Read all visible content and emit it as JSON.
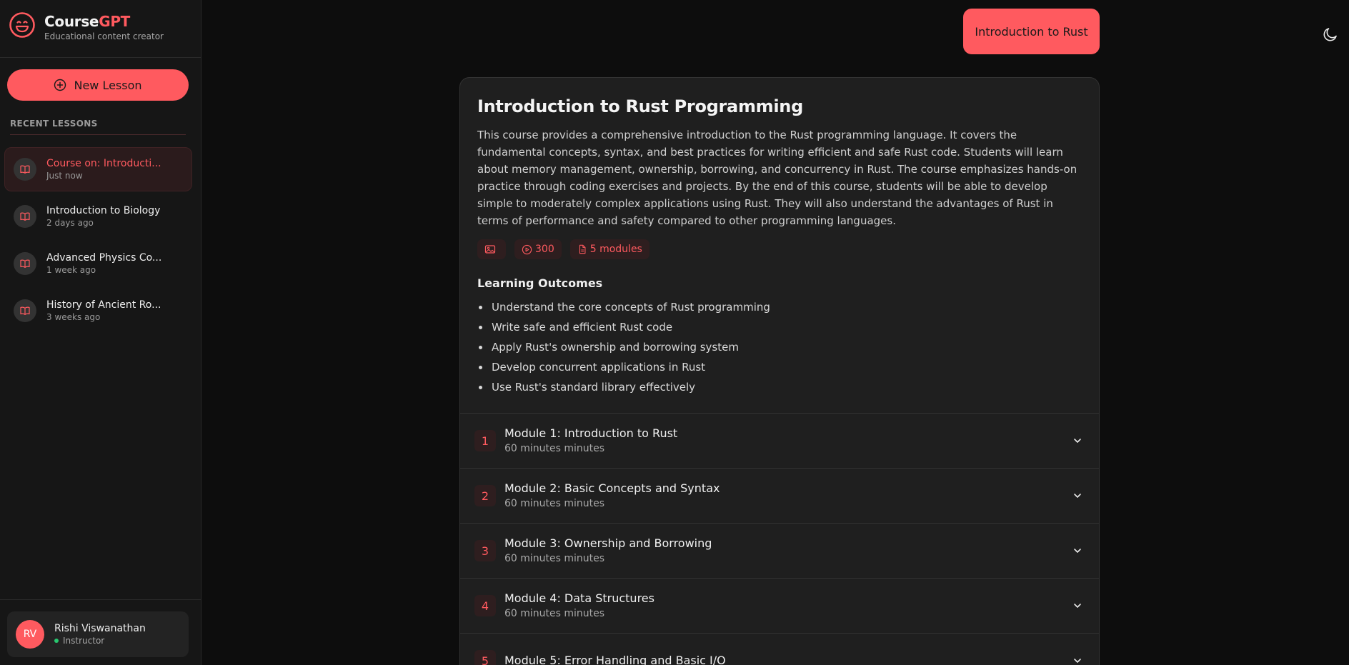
{
  "brand": {
    "name_main": "Course",
    "name_accent": "GPT",
    "subtitle": "Educational content creator"
  },
  "sidebar": {
    "new_lesson_label": "New Lesson",
    "recent_heading": "RECENT LESSONS",
    "lessons": [
      {
        "title": "Course on: Introducti...",
        "time": "Just now",
        "active": true
      },
      {
        "title": "Introduction to Biology",
        "time": "2 days ago"
      },
      {
        "title": "Advanced Physics Co...",
        "time": "1 week ago"
      },
      {
        "title": "History of Ancient Ro...",
        "time": "3 weeks ago"
      }
    ]
  },
  "user": {
    "initials": "RV",
    "name": "Rishi Viswanathan",
    "role": "Instructor",
    "status_color": "#28c76f"
  },
  "header": {
    "chip_label": "Introduction to Rust",
    "theme_icon": "moon-icon"
  },
  "course": {
    "title": "Introduction to Rust Programming",
    "description": "This course provides a comprehensive introduction to the Rust programming language. It covers the fundamental concepts, syntax, and best practices for writing efficient and safe Rust code. Students will learn about memory management, ownership, borrowing, and concurrency in Rust. The course emphasizes hands-on practice through coding exercises and projects. By the end of this course, students will be able to develop simple to moderately complex applications using Rust. They will also understand the advantages of Rust in terms of performance and safety compared to other programming languages.",
    "chips": {
      "image_icon": "image-icon",
      "duration": "300",
      "modules": "5 modules"
    },
    "outcomes_heading": "Learning Outcomes",
    "outcomes": [
      "Understand the core concepts of Rust programming",
      "Write safe and efficient Rust code",
      "Apply Rust's ownership and borrowing system",
      "Develop concurrent applications in Rust",
      "Use Rust's standard library effectively"
    ],
    "modules": [
      {
        "num": "1",
        "title": "Module 1: Introduction to Rust",
        "duration": "60 minutes minutes"
      },
      {
        "num": "2",
        "title": "Module 2: Basic Concepts and Syntax",
        "duration": "60 minutes minutes"
      },
      {
        "num": "3",
        "title": "Module 3: Ownership and Borrowing",
        "duration": "60 minutes minutes"
      },
      {
        "num": "4",
        "title": "Module 4: Data Structures",
        "duration": "60 minutes minutes"
      },
      {
        "num": "5",
        "title": "Module 5: Error Handling and Basic I/O",
        "duration": ""
      }
    ]
  },
  "colors": {
    "accent": "#ff5a5f",
    "background": "#0d0d0d",
    "sidebar": "#161616",
    "card": "#1f1f1f"
  }
}
